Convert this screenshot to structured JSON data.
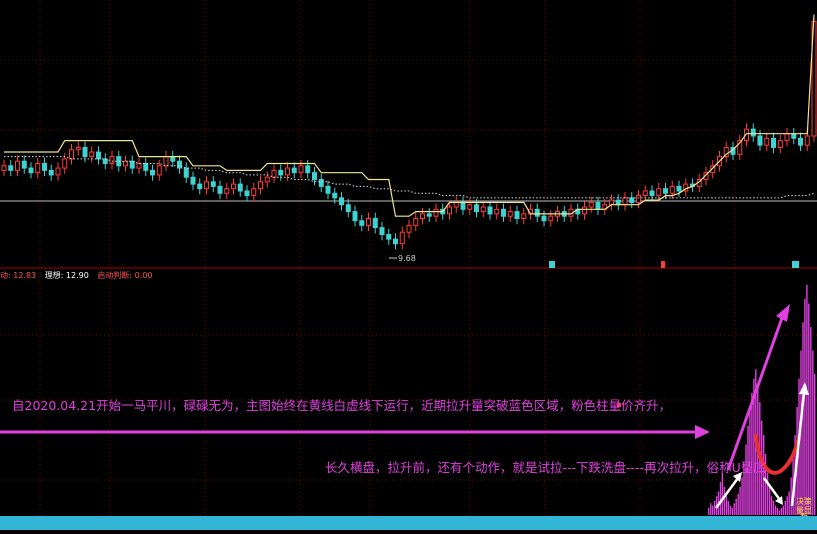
{
  "indicators": {
    "item1": "动: 12.83",
    "item2": "理想: 12.90",
    "item3": "启动判断: 0.00"
  },
  "price_low_label": "9.68",
  "annotations": {
    "line1": "自2020.04.21开始一马平川，碌碌无为，主图始终在黄线白虚线下运行，近期拉升量突破蓝色区域，粉色柱量价齐升，",
    "line2": "长久横盘，拉升前，还有个动作，就是试拉---下跌洗盘----再次拉升，俗称U型底"
  },
  "right_labels": [
    "决策",
    "量显",
    "数"
  ],
  "colors": {
    "up": "#ff3b3b",
    "down": "#3fd2d2",
    "yellow_line": "#f0e68c",
    "white_dotted": "#dddddd",
    "magenta": "#e040e0",
    "grid": "#7a0000",
    "bottom_strip": "#33b6d6"
  },
  "chart_data": [
    {
      "type": "candlestick",
      "title": "",
      "ylim": [
        9,
        20
      ],
      "close": [
        13.2,
        13.0,
        13.4,
        13.1,
        12.9,
        13.3,
        13.0,
        12.8,
        13.1,
        13.5,
        13.9,
        14.0,
        13.6,
        13.8,
        13.5,
        13.3,
        13.6,
        13.2,
        13.4,
        13.1,
        13.3,
        13.0,
        12.8,
        13.2,
        13.6,
        13.4,
        13.1,
        12.7,
        12.4,
        12.2,
        12.5,
        12.3,
        12.0,
        12.2,
        12.4,
        12.1,
        11.9,
        12.2,
        12.5,
        12.7,
        13.0,
        12.8,
        13.1,
        12.9,
        13.2,
        12.9,
        12.6,
        12.3,
        12.0,
        11.8,
        11.5,
        11.2,
        10.8,
        10.6,
        10.9,
        10.5,
        10.2,
        10.0,
        9.8,
        10.3,
        10.6,
        10.9,
        11.1,
        11.0,
        11.3,
        11.1,
        11.4,
        11.6,
        11.3,
        11.5,
        11.2,
        11.4,
        11.1,
        11.3,
        11.0,
        11.2,
        10.9,
        11.1,
        11.3,
        11.0,
        10.8,
        11.0,
        11.2,
        11.0,
        11.3,
        11.1,
        11.4,
        11.6,
        11.3,
        11.5,
        11.7,
        11.5,
        11.8,
        11.6,
        11.9,
        12.1,
        11.9,
        12.2,
        12.0,
        12.3,
        12.1,
        12.4,
        12.3,
        12.6,
        12.9,
        13.2,
        13.6,
        14.0,
        13.7,
        14.3,
        14.8,
        14.5,
        14.1,
        14.4,
        14.0,
        14.3,
        14.6,
        14.4,
        14.1,
        14.5,
        19.5
      ],
      "yellow_line": [
        13.8,
        13.8,
        13.8,
        13.8,
        13.8,
        13.8,
        13.8,
        13.8,
        13.8,
        14.3,
        14.3,
        14.3,
        14.3,
        14.3,
        14.3,
        14.3,
        14.3,
        14.3,
        14.3,
        14.3,
        13.6,
        13.6,
        13.6,
        13.6,
        13.6,
        13.6,
        13.6,
        13.6,
        13.2,
        13.2,
        13.2,
        13.2,
        13.2,
        13.0,
        13.0,
        13.0,
        13.0,
        13.0,
        13.0,
        13.3,
        13.3,
        13.3,
        13.3,
        13.3,
        13.3,
        13.3,
        13.3,
        12.9,
        12.9,
        12.9,
        12.9,
        12.9,
        12.9,
        12.9,
        12.6,
        12.6,
        12.6,
        12.6,
        11.0,
        11.0,
        11.0,
        11.2,
        11.2,
        11.2,
        11.2,
        11.2,
        11.6,
        11.6,
        11.6,
        11.6,
        11.6,
        11.6,
        11.6,
        11.6,
        11.6,
        11.6,
        11.6,
        11.6,
        11.1,
        11.1,
        11.1,
        11.1,
        11.1,
        11.1,
        11.1,
        11.3,
        11.3,
        11.3,
        11.3,
        11.3,
        11.5,
        11.5,
        11.5,
        11.5,
        11.5,
        11.7,
        11.7,
        11.7,
        11.9,
        11.9,
        12.0,
        12.2,
        12.3,
        12.5,
        12.8,
        13.1,
        13.4,
        13.7,
        13.9,
        14.2,
        14.6,
        14.6,
        14.6,
        14.6,
        14.6,
        14.6,
        14.6,
        14.6,
        14.6,
        14.6,
        19.8
      ],
      "white_dotted": [
        13.6,
        13.6,
        13.6,
        13.6,
        13.6,
        13.6,
        13.6,
        13.6,
        13.6,
        13.6,
        13.5,
        13.5,
        13.5,
        13.5,
        13.5,
        13.5,
        13.4,
        13.4,
        13.4,
        13.4,
        13.3,
        13.3,
        13.3,
        13.3,
        13.2,
        13.2,
        13.2,
        13.1,
        13.1,
        13.1,
        13.0,
        13.0,
        13.0,
        12.9,
        12.9,
        12.9,
        12.8,
        12.8,
        12.8,
        12.8,
        12.7,
        12.7,
        12.7,
        12.6,
        12.6,
        12.6,
        12.5,
        12.5,
        12.5,
        12.4,
        12.4,
        12.4,
        12.3,
        12.3,
        12.3,
        12.2,
        12.2,
        12.2,
        12.1,
        12.1,
        12.1,
        12.0,
        12.0,
        12.0,
        12.0,
        11.9,
        11.9,
        11.9,
        11.9,
        11.8,
        11.8,
        11.8,
        11.8,
        11.8,
        11.8,
        11.8,
        11.8,
        11.8,
        11.8,
        11.8,
        11.8,
        11.8,
        11.8,
        11.8,
        11.8,
        11.8,
        11.8,
        11.8,
        11.8,
        11.8,
        11.8,
        11.8,
        11.8,
        11.8,
        11.8,
        11.8,
        11.8,
        11.8,
        11.8,
        11.8,
        11.8,
        11.8,
        11.8,
        11.8,
        11.8,
        11.8,
        11.8,
        11.8,
        11.8,
        11.8,
        11.8,
        11.8,
        11.8,
        11.8,
        11.8,
        11.8,
        11.9,
        11.9,
        11.9,
        11.9,
        12.0
      ]
    },
    {
      "type": "bar",
      "title": "",
      "ylim": [
        0,
        100
      ],
      "values": [
        3,
        5,
        4,
        6,
        8,
        10,
        14,
        18,
        12,
        8,
        6,
        4,
        3,
        5,
        7,
        9,
        12,
        16,
        22,
        30,
        38,
        45,
        52,
        58,
        62,
        55,
        48,
        40,
        34,
        26,
        18,
        12,
        8,
        6,
        4,
        3,
        2,
        3,
        4,
        6,
        8,
        10,
        16,
        24,
        34,
        46,
        58,
        70,
        82,
        92,
        98,
        90,
        80,
        70,
        60
      ]
    }
  ]
}
